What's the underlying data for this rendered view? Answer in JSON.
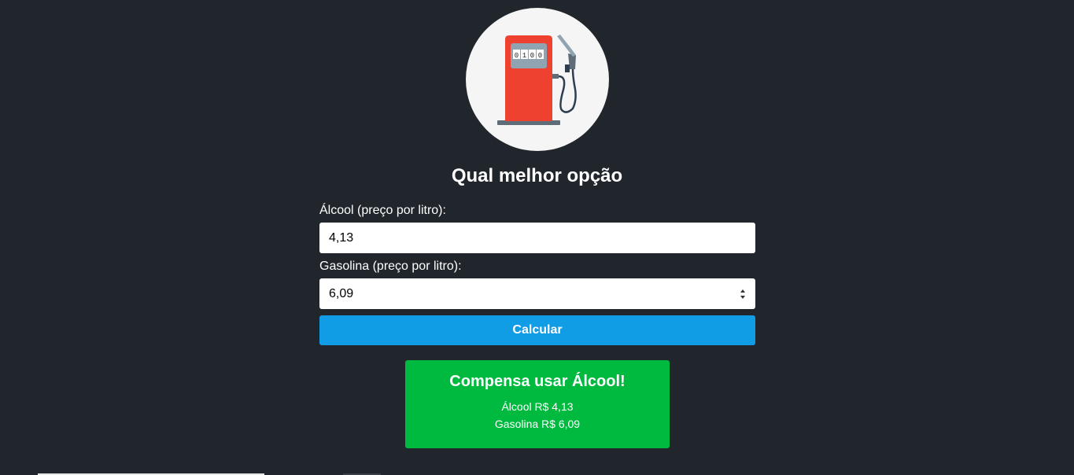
{
  "logo": {
    "icon": "fuel-pump-icon",
    "meter": [
      "0",
      "1",
      "0",
      "0"
    ]
  },
  "title": "Qual melhor opção",
  "form": {
    "alcool_label": "Álcool (preço por litro):",
    "alcool_value": "4,13",
    "gasolina_label": "Gasolina (preço por litro):",
    "gasolina_value": "6,09",
    "submit_label": "Calcular"
  },
  "result": {
    "heading": "Compensa usar Álcool!",
    "alcool_line": "Álcool R$ 4,13",
    "gasolina_line": "Gasolina R$ 6,09"
  },
  "colors": {
    "background": "#21252c",
    "button": "#119ce6",
    "result": "#00b93f",
    "pump_body": "#ef4130"
  }
}
